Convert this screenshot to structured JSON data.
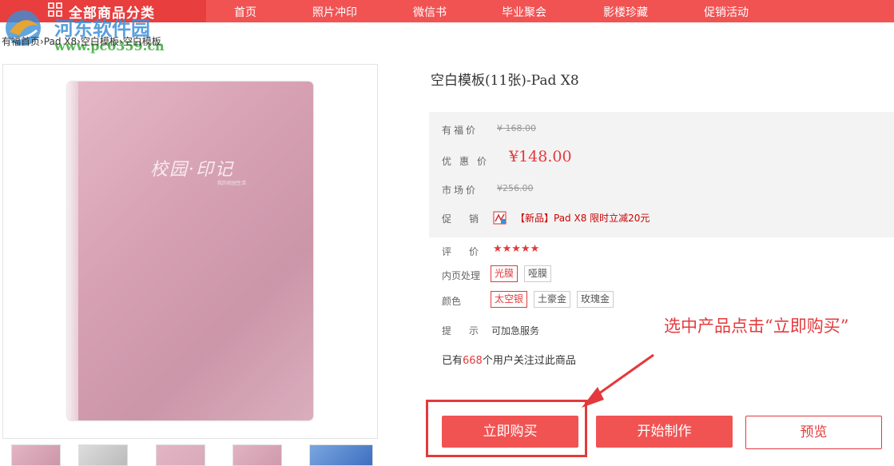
{
  "nav": {
    "category_label": "全部商品分类",
    "items": [
      "首页",
      "照片冲印",
      "微信书",
      "毕业聚会",
      "影楼珍藏",
      "促销活动"
    ]
  },
  "watermark": {
    "title": "河东软件园",
    "url": "www.pc0359.cn"
  },
  "breadcrumb": "有福首页›Pad X8›空白模板›空白模板",
  "product_image": {
    "cover_text": "校园·印记",
    "cover_subtext": "我的校园生活"
  },
  "product": {
    "title": "空白模板(11张)-Pad X8",
    "youfu_price_label": "有福价",
    "youfu_price": "¥ 168.00",
    "discount_price_label": "优惠价",
    "discount_price": "¥148.00",
    "market_price_label": "市场价",
    "market_price": "¥256.00",
    "promo_label": "促销",
    "promo_text": "【新品】Pad X8 限时立减20元",
    "rating_label": "评价",
    "rating_stars": "★★★★★",
    "rating": 5,
    "inner_label": "内页处理",
    "inner_options": [
      "光膜",
      "哑膜"
    ],
    "color_label": "颜色",
    "color_options": [
      "太空银",
      "土豪金",
      "玫瑰金"
    ],
    "tip_label": "提示",
    "tip_text": "可加急服务",
    "follow_prefix": "已有",
    "follow_count": "668",
    "follow_suffix": "个用户关注过此商品"
  },
  "annotation": "选中产品点击“立即购买”",
  "buttons": {
    "buy": "立即购买",
    "make": "开始制作",
    "preview": "预览"
  },
  "colors": {
    "accent": "#f15353",
    "price_red": "#e4393c"
  }
}
